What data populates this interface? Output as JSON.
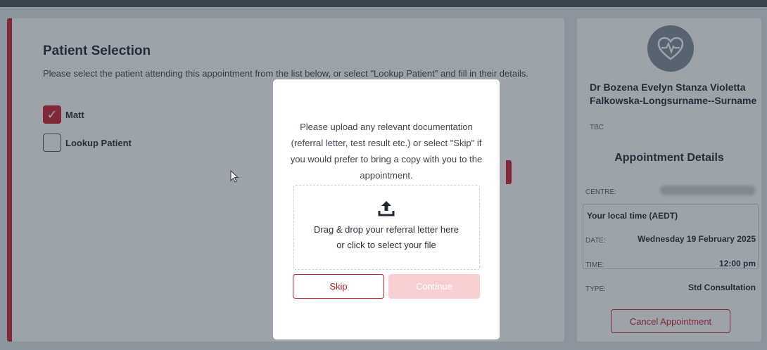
{
  "patient_selection": {
    "title": "Patient Selection",
    "description": "Please select the patient attending this appointment from the list below, or select \"Lookup Patient\" and fill in their details.",
    "options": [
      {
        "label": "Matt",
        "checked": true
      },
      {
        "label": "Lookup Patient",
        "checked": false
      }
    ]
  },
  "doctor": {
    "name": "Dr Bozena Evelyn Stanza Violetta Falkowska-Longsurname--Surname",
    "subtitle": "TBC",
    "avatar_icon": "heart-pulse-icon"
  },
  "appointment": {
    "title": "Appointment Details",
    "centre_label": "CENTRE:",
    "local_time_title": "Your local time (AEDT)",
    "date_label": "DATE:",
    "date_value": "Wednesday 19 February 2025",
    "time_label": "TIME:",
    "time_value": "12:00 pm",
    "type_label": "TYPE:",
    "type_value": "Std Consultation",
    "cancel_label": "Cancel Appointment"
  },
  "modal": {
    "message": "Please upload any relevant documentation (referral letter, test result etc.) or select \"Skip\" if you would prefer to bring a copy with you to the appointment.",
    "dropzone_line1": "Drag & drop your referral letter here",
    "dropzone_line2": "or click to select your file",
    "skip_label": "Skip",
    "continue_label": "Continue"
  },
  "colors": {
    "accent": "#c8202f",
    "disabled_accent": "#f7cfd3",
    "overlay": "#283442"
  }
}
